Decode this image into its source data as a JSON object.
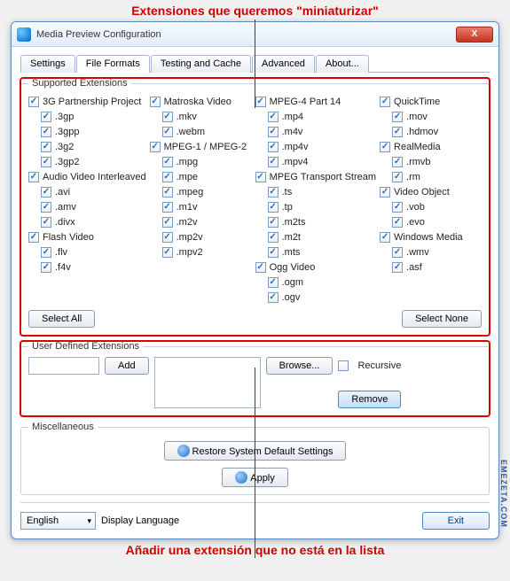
{
  "annotation_top": "Extensiones que queremos \"miniaturizar\"",
  "annotation_bottom": "Añadir una extensión que no está en la lista",
  "watermark": "EMEZETA.COM",
  "window": {
    "title": "Media Preview Configuration",
    "close": "X"
  },
  "tabs": {
    "settings": "Settings",
    "file_formats": "File Formats",
    "testing": "Testing and Cache",
    "advanced": "Advanced",
    "about": "About..."
  },
  "supported": {
    "legend": "Supported Extensions",
    "select_all": "Select All",
    "select_none": "Select None",
    "cols": [
      [
        {
          "l": "3G Partnership Project",
          "c": true
        },
        {
          "l": ".3gp",
          "c": true
        },
        {
          "l": ".3gpp",
          "c": true
        },
        {
          "l": ".3g2",
          "c": true
        },
        {
          "l": ".3gp2",
          "c": true
        },
        {
          "l": "Audio Video Interleaved",
          "c": true
        },
        {
          "l": ".avi",
          "c": true
        },
        {
          "l": ".amv",
          "c": true
        },
        {
          "l": ".divx",
          "c": true
        },
        {
          "l": "Flash Video",
          "c": true
        },
        {
          "l": ".flv",
          "c": true
        },
        {
          "l": ".f4v",
          "c": true
        }
      ],
      [
        {
          "l": "Matroska Video",
          "c": true
        },
        {
          "l": ".mkv",
          "c": true
        },
        {
          "l": ".webm",
          "c": true
        },
        {
          "l": "MPEG-1 / MPEG-2",
          "c": true
        },
        {
          "l": ".mpg",
          "c": true
        },
        {
          "l": ".mpe",
          "c": true
        },
        {
          "l": ".mpeg",
          "c": true
        },
        {
          "l": ".m1v",
          "c": true
        },
        {
          "l": ".m2v",
          "c": true
        },
        {
          "l": ".mp2v",
          "c": true
        },
        {
          "l": ".mpv2",
          "c": true
        }
      ],
      [
        {
          "l": "MPEG-4 Part 14",
          "c": true
        },
        {
          "l": ".mp4",
          "c": true
        },
        {
          "l": ".m4v",
          "c": true
        },
        {
          "l": ".mp4v",
          "c": true
        },
        {
          "l": ".mpv4",
          "c": true
        },
        {
          "l": "MPEG Transport Stream",
          "c": true
        },
        {
          "l": ".ts",
          "c": true
        },
        {
          "l": ".tp",
          "c": true
        },
        {
          "l": ".m2ts",
          "c": true
        },
        {
          "l": ".m2t",
          "c": true
        },
        {
          "l": ".mts",
          "c": true
        },
        {
          "l": "Ogg Video",
          "c": true
        },
        {
          "l": ".ogm",
          "c": true
        },
        {
          "l": ".ogv",
          "c": true
        }
      ],
      [
        {
          "l": "QuickTime",
          "c": true
        },
        {
          "l": ".mov",
          "c": true
        },
        {
          "l": ".hdmov",
          "c": true
        },
        {
          "l": "RealMedia",
          "c": true
        },
        {
          "l": ".rmvb",
          "c": true
        },
        {
          "l": ".rm",
          "c": true
        },
        {
          "l": "Video Object",
          "c": true
        },
        {
          "l": ".vob",
          "c": true
        },
        {
          "l": ".evo",
          "c": true
        },
        {
          "l": "Windows Media",
          "c": true
        },
        {
          "l": ".wmv",
          "c": true
        },
        {
          "l": ".asf",
          "c": true
        }
      ]
    ]
  },
  "user_defined": {
    "legend": "User Defined Extensions",
    "add": "Add",
    "browse": "Browse...",
    "recursive": "Recursive",
    "remove": "Remove",
    "ext_value": "",
    "listbox_items": []
  },
  "misc": {
    "legend": "Miscellaneous",
    "restore": "Restore System Default Settings",
    "apply": "Apply"
  },
  "footer": {
    "language": "English",
    "language_label": "Display Language",
    "exit": "Exit"
  }
}
